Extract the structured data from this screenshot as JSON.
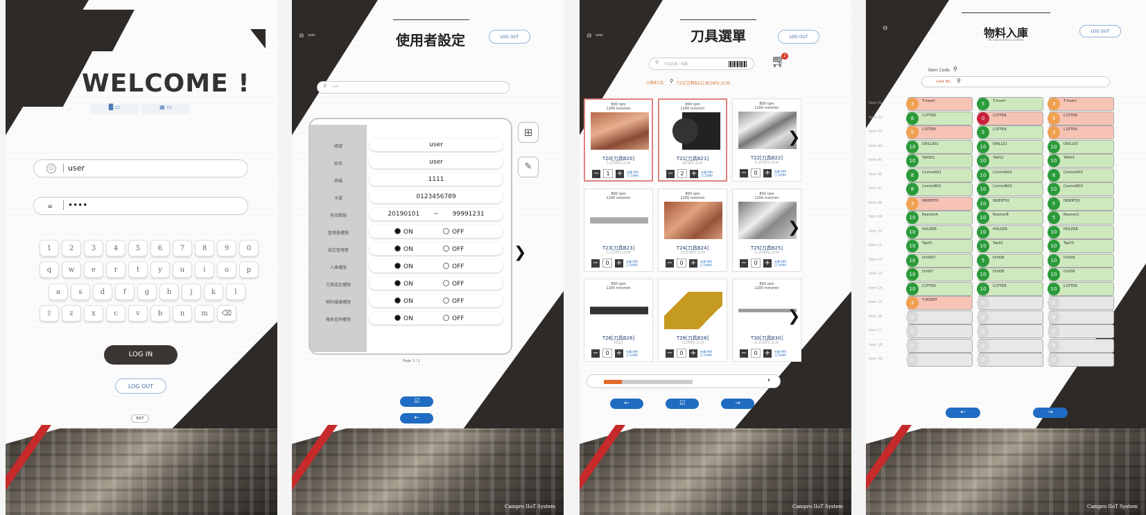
{
  "p1": {
    "welcome": "WELCOME !",
    "toggle_left": "█ ▭",
    "toggle_right": "▦ ▭",
    "username": "user",
    "password": "••••",
    "keys_row1": [
      "1",
      "2",
      "3",
      "4",
      "5",
      "6",
      "7",
      "8",
      "9",
      "0"
    ],
    "keys_row2": [
      "q",
      "w",
      "e",
      "r",
      "t",
      "y",
      "u",
      "i",
      "o",
      "p"
    ],
    "keys_row3": [
      "a",
      "s",
      "d",
      "f",
      "g",
      "h",
      "j",
      "k",
      "l"
    ],
    "keys_row4": [
      "⇧",
      "z",
      "x",
      "c",
      "v",
      "b",
      "n",
      "m",
      "⌫"
    ],
    "login": "LOG IN",
    "logout": "LOG OUT",
    "exit": "EXIT"
  },
  "p2": {
    "user": "user",
    "title": "使用者設定",
    "logout": "LOG OUT",
    "search_placeholder": "user",
    "rows": [
      {
        "label": "帳號",
        "value": "user"
      },
      {
        "label": "姓名",
        "value": "user"
      },
      {
        "label": "密碼",
        "value": "1111"
      },
      {
        "label": "卡號",
        "value": "0123456789"
      },
      {
        "label": "有效期限",
        "value_from": "20190101",
        "sep": "~",
        "value_to": "99991231"
      }
    ],
    "toggles": [
      {
        "label": "管理員權限",
        "on": "ON",
        "off": "OFF"
      },
      {
        "label": "設定管理者",
        "on": "ON",
        "off": "OFF"
      },
      {
        "label": "入庫權限",
        "on": "ON",
        "off": "OFF"
      },
      {
        "label": "刀具設定權限",
        "on": "ON",
        "off": "OFF"
      },
      {
        "label": "物料維護權限",
        "on": "ON",
        "off": "OFF"
      },
      {
        "label": "報表查詢權限",
        "on": "ON",
        "off": "OFF"
      }
    ],
    "page": "Page 1 / 1",
    "save": "☑",
    "back": "←",
    "footer": "Campro IIoT System"
  },
  "p3": {
    "user": "user",
    "title": "刀具選單",
    "logout": "LOG OUT",
    "search_placeholder": "刀具名稱 / 條碼",
    "selected_label": "已選擇刀具",
    "selected_value": "T21[刀具B21] BCNF0.2CM",
    "cart_count": "2",
    "cards": [
      {
        "name": "T20[刀具B20]",
        "sub": "0.2CMF0.2CM",
        "speed": "800 rpm\n1200 mm/min",
        "qty": "1",
        "stock": "在庫 999\n已 1/999"
      },
      {
        "name": "T21[刀具B21]",
        "sub": "BCNF0.2CM",
        "speed": "800 rpm\n1200 mm/min",
        "qty": "2",
        "stock": "在庫 999\n已 2/999"
      },
      {
        "name": "T22[刀具B22]",
        "sub": "0.2CMF0.2CM",
        "speed": "800 rpm\n1200 mm/min",
        "qty": "0",
        "stock": "在庫 999\n已 0/999"
      },
      {
        "name": "T23[刀具B23]",
        "sub": "0.2CMF0.2CM",
        "speed": "800 rpm\n1200 mm/min",
        "qty": "0",
        "stock": "在庫 999\n已 0/999"
      },
      {
        "name": "T24[刀具B24]",
        "sub": "T22CMF0.2CM",
        "speed": "800 rpm\n1200 mm/min",
        "qty": "0",
        "stock": "在庫 999\n已 0/999"
      },
      {
        "name": "T25[刀具B25]",
        "sub": "0.2CMF0.2CM",
        "speed": "800 rpm\n1200 mm/min",
        "qty": "0",
        "stock": "在庫 999\n已 0/999"
      },
      {
        "name": "T26[刀具B26]",
        "sub": "0dd2",
        "speed": "800 rpm\n1200 mm/min",
        "qty": "0",
        "stock": "在庫 999\n已 0/999"
      },
      {
        "name": "T28[刀具B28]",
        "sub": "T22MF0.2CM",
        "speed": "",
        "qty": "0",
        "stock": "在庫 999\n已 0/999"
      },
      {
        "name": "T30[刀具B30]",
        "sub": "0.2CMF0.2CM",
        "speed": "800 rpm\n1200 mm/min",
        "qty": "0",
        "stock": "在庫 999\n已 0/999"
      }
    ],
    "scroll_progress": 0.1,
    "footer": "Campro IIoT System"
  },
  "p4": {
    "title": "物料入庫",
    "subtitle": "Pls select item to confirm",
    "logout": "LOG OUT",
    "item_code_label": "Item Code",
    "lane_label": "Lane No.",
    "row_labels": [
      "Item 01",
      "Item 02",
      "Item 03",
      "Item 04",
      "Item 05",
      "Item 06",
      "Item 07",
      "Item 08",
      "Item 09",
      "Item 10",
      "Item 11",
      "Item 12",
      "Item 13",
      "Item 14",
      "Item 15",
      "Item 16",
      "Item 17",
      "Item 18",
      "Item 19"
    ],
    "columns": [
      {
        "items": [
          {
            "n": "3",
            "c": "o",
            "t": "T-Insert"
          },
          {
            "n": "6",
            "c": "g",
            "t": "CUTTER"
          },
          {
            "n": "5",
            "c": "o",
            "t": "CUTTER"
          },
          {
            "n": "10",
            "c": "g",
            "t": "DRILL001"
          },
          {
            "n": "10",
            "c": "g",
            "t": "TAP001"
          },
          {
            "n": "8",
            "c": "g",
            "t": "ControlA01"
          },
          {
            "n": "8",
            "c": "g",
            "t": "ControlB01"
          },
          {
            "n": "3",
            "c": "o",
            "t": "INSERT01"
          },
          {
            "n": "10",
            "c": "g",
            "t": "ReamerA"
          },
          {
            "n": "10",
            "c": "g",
            "t": "HOLDER"
          },
          {
            "n": "10",
            "c": "g",
            "t": "Tap01"
          },
          {
            "n": "10",
            "c": "g",
            "t": "Drill007"
          },
          {
            "n": "10",
            "c": "g",
            "t": "Drill07"
          },
          {
            "n": "10",
            "c": "g",
            "t": "CUTTER"
          },
          {
            "n": "3",
            "c": "o",
            "t": "T-INSERT"
          },
          {
            "n": "0",
            "c": "e",
            "t": ""
          },
          {
            "n": "0",
            "c": "e",
            "t": ""
          },
          {
            "n": "0",
            "c": "e",
            "t": ""
          },
          {
            "n": "0",
            "c": "e",
            "t": ""
          }
        ]
      },
      {
        "items": [
          {
            "n": "5",
            "c": "g",
            "t": "T-Insert"
          },
          {
            "n": "0",
            "c": "r",
            "t": "CUTTER"
          },
          {
            "n": "5",
            "c": "g",
            "t": "CUTTER"
          },
          {
            "n": "10",
            "c": "g",
            "t": "DRILL02"
          },
          {
            "n": "10",
            "c": "g",
            "t": "TAP02"
          },
          {
            "n": "10",
            "c": "g",
            "t": "ControlA02"
          },
          {
            "n": "10",
            "c": "g",
            "t": "ControlB02"
          },
          {
            "n": "10",
            "c": "g",
            "t": "INSERT02"
          },
          {
            "n": "10",
            "c": "g",
            "t": "ReamerB"
          },
          {
            "n": "10",
            "c": "g",
            "t": "HOLDER"
          },
          {
            "n": "10",
            "c": "g",
            "t": "Tap02"
          },
          {
            "n": "5",
            "c": "g",
            "t": "Drill08"
          },
          {
            "n": "10",
            "c": "g",
            "t": "Drill08"
          },
          {
            "n": "10",
            "c": "g",
            "t": "CUTTER"
          },
          {
            "n": "0",
            "c": "e",
            "t": ""
          },
          {
            "n": "0",
            "c": "e",
            "t": ""
          },
          {
            "n": "0",
            "c": "e",
            "t": ""
          },
          {
            "n": "0",
            "c": "e",
            "t": ""
          },
          {
            "n": "0",
            "c": "e",
            "t": ""
          }
        ]
      },
      {
        "items": [
          {
            "n": "3",
            "c": "o",
            "t": "T-Insert"
          },
          {
            "n": "3",
            "c": "o",
            "t": "CUTTER"
          },
          {
            "n": "3",
            "c": "o",
            "t": "CUTTER"
          },
          {
            "n": "10",
            "c": "g",
            "t": "DRILL03"
          },
          {
            "n": "10",
            "c": "g",
            "t": "TAP03"
          },
          {
            "n": "8",
            "c": "g",
            "t": "ControlA03"
          },
          {
            "n": "10",
            "c": "g",
            "t": "ControlB03"
          },
          {
            "n": "5",
            "c": "g",
            "t": "INSERT03"
          },
          {
            "n": "5",
            "c": "g",
            "t": "ReamerC"
          },
          {
            "n": "10",
            "c": "g",
            "t": "HOLDER"
          },
          {
            "n": "10",
            "c": "g",
            "t": "Tap03"
          },
          {
            "n": "10",
            "c": "g",
            "t": "Drill09"
          },
          {
            "n": "10",
            "c": "g",
            "t": "Drill09"
          },
          {
            "n": "10",
            "c": "g",
            "t": "CUTTER"
          },
          {
            "n": "0",
            "c": "e",
            "t": ""
          },
          {
            "n": "0",
            "c": "e",
            "t": ""
          },
          {
            "n": "0",
            "c": "e",
            "t": ""
          },
          {
            "n": "0",
            "c": "e",
            "t": ""
          },
          {
            "n": "0",
            "c": "e",
            "t": ""
          }
        ]
      }
    ],
    "prev": "←",
    "next": "→",
    "footer": "Campro IIoT System",
    "colors": {
      "orange": "#f0a050",
      "green": "#2a9a3a",
      "red": "#c8203a",
      "empty": "#d9d9d9",
      "cell_green": "#cfe9bf",
      "cell_red": "#f6c3b5",
      "cell_empty": "#e7e7e7"
    }
  }
}
